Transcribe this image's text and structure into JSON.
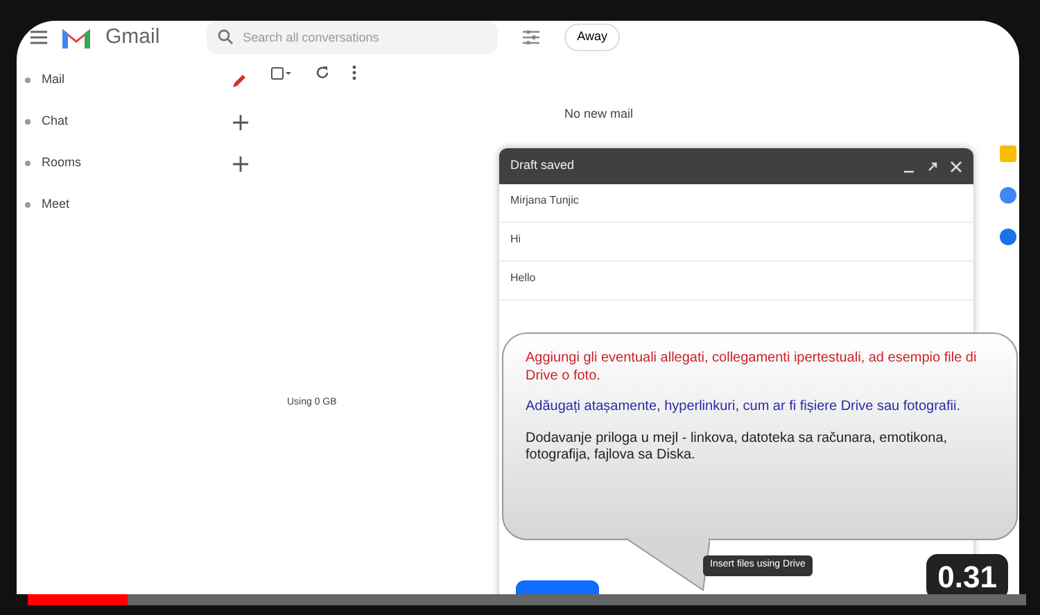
{
  "app": {
    "name": "Gmail",
    "search_placeholder": "Search all conversations",
    "status": "Away"
  },
  "sidebar": {
    "items": [
      {
        "label": "Mail",
        "kind": "compose"
      },
      {
        "label": "Chat",
        "kind": "add"
      },
      {
        "label": "Rooms",
        "kind": "add"
      },
      {
        "label": "Meet",
        "kind": "plain"
      }
    ]
  },
  "mail_list": {
    "empty_text": "No new mail",
    "storage": "Using 0 GB"
  },
  "compose": {
    "title": "Draft saved",
    "to": "Mirjana Tunjic",
    "subject": "Hi",
    "body": "Hello",
    "tooltip": "Insert files using Drive"
  },
  "callout": {
    "paragraphs": [
      {
        "text": "Aggiungi gli eventuali allegati, collegamenti ipertestuali, ad esempio file di Drive o foto.",
        "color": "#d0202a"
      },
      {
        "text": "Adăugați atașamente, hyperlinkuri, cum ar fi fișiere Drive sau fotografii.",
        "color": "#2a2aa8"
      },
      {
        "text": "Dodavanje priloga u mejl - linkova, datoteka sa računara, emotikona, fotografija, fajlova sa Diska.",
        "color": "#222222"
      }
    ]
  },
  "video": {
    "duration": "0.31",
    "progress": {
      "level": 0.1
    }
  }
}
